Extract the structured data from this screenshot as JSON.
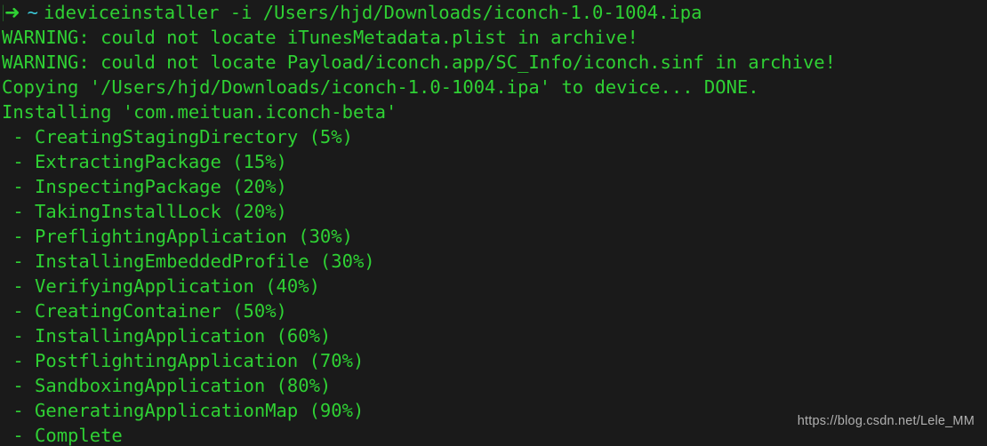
{
  "terminal": {
    "background_color": "#1a1a1a",
    "foreground_color": "#2fd134",
    "accent_color": "#3bc9d8",
    "prompt": {
      "bracket_fragment": "[",
      "arrow_icon": "➜",
      "path": "~",
      "command": "ideviceinstaller -i /Users/hjd/Downloads/iconch-1.0-1004.ipa"
    },
    "output_lines": [
      "WARNING: could not locate iTunesMetadata.plist in archive!",
      "WARNING: could not locate Payload/iconch.app/SC_Info/iconch.sinf in archive!",
      "Copying '/Users/hjd/Downloads/iconch-1.0-1004.ipa' to device... DONE.",
      "Installing 'com.meituan.iconch-beta'",
      " - CreatingStagingDirectory (5%)",
      " - ExtractingPackage (15%)",
      " - InspectingPackage (20%)",
      " - TakingInstallLock (20%)",
      " - PreflightingApplication (30%)",
      " - InstallingEmbeddedProfile (30%)",
      " - VerifyingApplication (40%)",
      " - CreatingContainer (50%)",
      " - InstallingApplication (60%)",
      " - PostflightingApplication (70%)",
      " - SandboxingApplication (80%)",
      " - GeneratingApplicationMap (90%)",
      " - Complete"
    ]
  },
  "watermark": {
    "text": "https://blog.csdn.net/Lele_MM"
  }
}
